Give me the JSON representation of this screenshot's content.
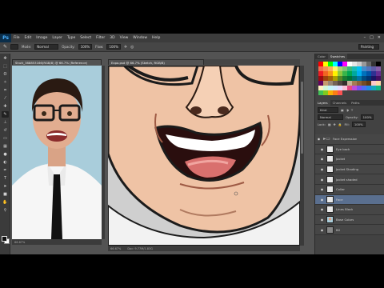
{
  "app": {
    "logo": "Ps",
    "menu": [
      "File",
      "Edit",
      "Image",
      "Layer",
      "Type",
      "Select",
      "Filter",
      "3D",
      "View",
      "Window",
      "Help"
    ],
    "window_controls": [
      "–",
      "□",
      "✕"
    ],
    "workspace": "Painting"
  },
  "options": {
    "mode_label": "Mode:",
    "mode_value": "Normal",
    "opacity_label": "Opacity:",
    "opacity_value": "100%",
    "flow_label": "Flow:",
    "flow_value": "100%"
  },
  "documents": {
    "doc1_tab": "Shutt_388853166(RGB/8) @ 66.7% (Reference)",
    "doc2_tab": "Expo.psd @ 66.7% (Sketch, RGB/8)",
    "doc1_zoom": "66.67%",
    "doc2_zoom": "66.67%",
    "doc2_docsize": "Doc: 9.77M/1.83G"
  },
  "panels": {
    "swatches_tabs": [
      "Color",
      "Swatches"
    ],
    "layers_tabs": [
      "Layers",
      "Channels",
      "Paths"
    ],
    "kind_label": "Kind",
    "blend_value": "Normal",
    "opacity_label": "Opacity:",
    "opacity_value": "100%",
    "lock_label": "Lock:",
    "fill_label": "Fill:",
    "fill_value": "100%"
  },
  "swatch_colors": [
    "#ff0000",
    "#ffff00",
    "#00ff00",
    "#00ffff",
    "#0000ff",
    "#ff00ff",
    "#ffffff",
    "#e6e6e6",
    "#cccccc",
    "#999999",
    "#666666",
    "#333333",
    "#000000",
    "#f26c4f",
    "#f68e55",
    "#fbaf5c",
    "#fff467",
    "#acd372",
    "#7cc576",
    "#3bb878",
    "#1abbb4",
    "#00bff3",
    "#438ccb",
    "#5574b9",
    "#605ca8",
    "#855fa8",
    "#ed1c24",
    "#f26522",
    "#f7941d",
    "#fff200",
    "#8dc63f",
    "#39b54a",
    "#00a651",
    "#00a99d",
    "#00aeef",
    "#0072bc",
    "#0054a6",
    "#2e3192",
    "#662d91",
    "#9e0b0f",
    "#a0410d",
    "#a36209",
    "#aba000",
    "#598527",
    "#197b30",
    "#007236",
    "#00746b",
    "#0076a3",
    "#004a80",
    "#003471",
    "#1b1464",
    "#440e62",
    "#630460",
    "#c69c6d",
    "#998675",
    "#736357",
    "#534741",
    "#362f2d",
    "#c7b299",
    "#a67c52",
    "#8c6239",
    "#754c24",
    "#603913",
    "#ffc9c9",
    "#ffd8a8",
    "#fff3bf",
    "#d3f9d8",
    "#c5f6fa",
    "#d0ebff",
    "#e5dbff",
    "#fcc2d7",
    "#e64980",
    "#be4bdb",
    "#7950f2",
    "#4c6ef5",
    "#228be6",
    "#15aabf",
    "#12b886",
    "#40c057",
    "#82c91e",
    "#fab005",
    "#fd7e14",
    "#fa5252"
  ],
  "layers": [
    {
      "name": "Face Expression",
      "type": "folder",
      "selected": false
    },
    {
      "name": "Eye back",
      "type": "layer",
      "selected": false
    },
    {
      "name": "Jacket",
      "type": "layer",
      "selected": false
    },
    {
      "name": "Jacket Shading",
      "type": "layer",
      "selected": false
    },
    {
      "name": "Jacket shaded",
      "type": "layer",
      "selected": false
    },
    {
      "name": "Collar",
      "type": "layer",
      "selected": false
    },
    {
      "name": "Face",
      "type": "layer",
      "selected": true
    },
    {
      "name": "Lines Black",
      "type": "layer",
      "selected": false
    },
    {
      "name": "Base Colors",
      "type": "photo",
      "selected": false
    },
    {
      "name": "BG",
      "type": "grey",
      "selected": false
    }
  ]
}
